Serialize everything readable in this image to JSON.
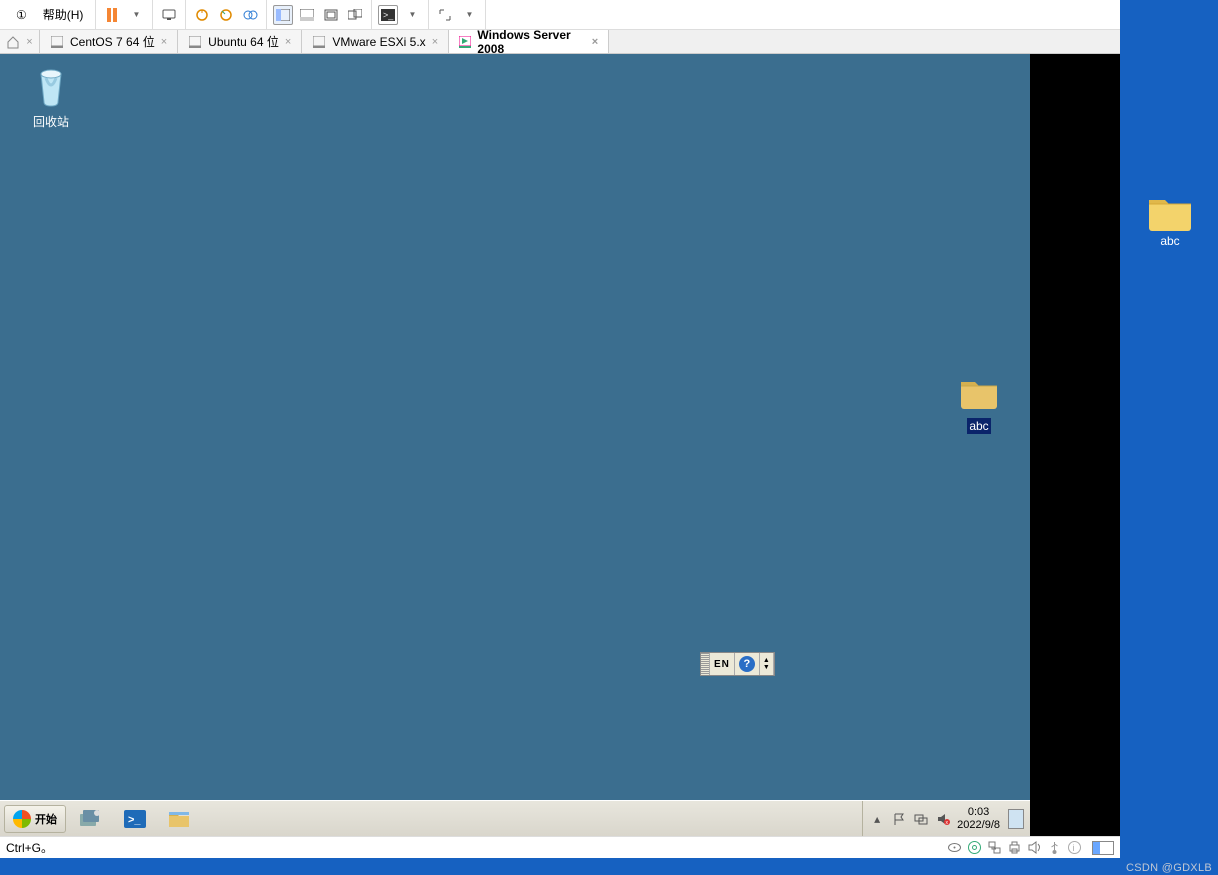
{
  "toolbar": {
    "menu1": "①",
    "menu2": "帮助(H)"
  },
  "tabs": [
    {
      "label": "CentOS 7 64 位",
      "active": false,
      "closable": true
    },
    {
      "label": "Ubuntu 64 位",
      "active": false,
      "closable": true
    },
    {
      "label": "VMware ESXi 5.x",
      "active": false,
      "closable": true
    },
    {
      "label": "Windows Server 2008",
      "active": true,
      "closable": true
    }
  ],
  "guest": {
    "recycle_label": "回收站",
    "folder_label": "abc",
    "langbar": {
      "lang": "EN",
      "help": "?"
    },
    "start_label": "开始",
    "clock_time": "0:03",
    "clock_date": "2022/9/8"
  },
  "statusbar": {
    "hint": "Ctrl+G。"
  },
  "host": {
    "folder_label": "abc"
  },
  "watermark": "CSDN @GDXLB"
}
